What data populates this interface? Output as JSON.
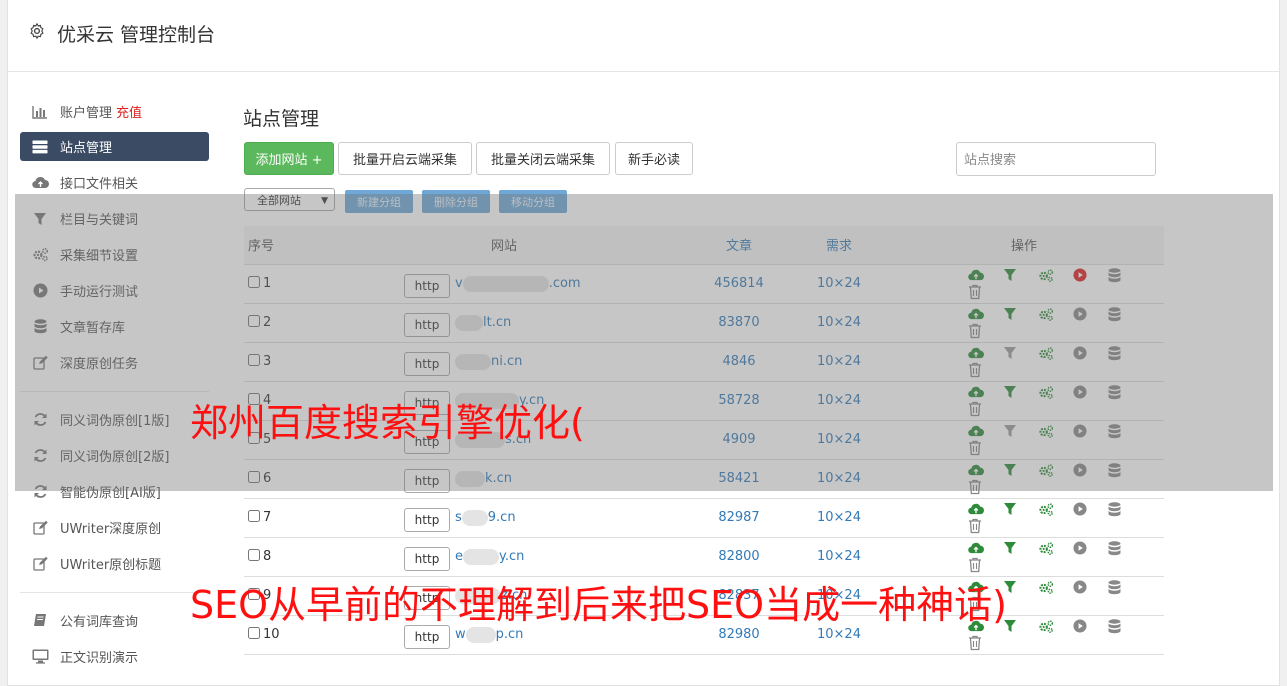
{
  "header": {
    "title": "优采云 管理控制台",
    "icon": "gear-icon"
  },
  "sidebar": {
    "items": [
      {
        "label": "账户管理",
        "badge": "充值",
        "icon": "bar-chart-icon"
      },
      {
        "label": "站点管理",
        "icon": "server-icon",
        "active": true
      },
      {
        "label": "接口文件相关",
        "icon": "cloud-upload-icon"
      },
      {
        "label": "栏目与关键词",
        "icon": "filter-icon"
      },
      {
        "label": "采集细节设置",
        "icon": "cogs-icon"
      },
      {
        "label": "手动运行测试",
        "icon": "play-circle-icon"
      },
      {
        "label": "文章暂存库",
        "icon": "database-icon"
      },
      {
        "label": "深度原创任务",
        "icon": "edit-icon"
      },
      {
        "label": "同义词伪原创[1版]",
        "icon": "refresh-icon"
      },
      {
        "label": "同义词伪原创[2版]",
        "icon": "refresh-icon"
      },
      {
        "label": "智能伪原创[AI版]",
        "icon": "refresh-icon"
      },
      {
        "label": "UWriter深度原创",
        "icon": "edit-icon"
      },
      {
        "label": "UWriter原创标题",
        "icon": "edit-icon"
      },
      {
        "label": "公有词库查询",
        "icon": "book-icon"
      },
      {
        "label": "正文识别演示",
        "icon": "monitor-icon"
      }
    ]
  },
  "main": {
    "title": "站点管理",
    "buttons": {
      "add": "添加网站 +",
      "batch_open": "批量开启云端采集",
      "batch_close": "批量关闭云端采集",
      "guide": "新手必读"
    },
    "search_placeholder": "站点搜索",
    "group_select": "全部网站",
    "group_buttons": {
      "new": "新建分组",
      "delete": "删除分组",
      "move": "移动分组"
    },
    "columns": {
      "no": "序号",
      "site": "网站",
      "articles": "文章",
      "demand": "需求",
      "ops": "操作"
    },
    "rows": [
      {
        "no": "1",
        "proto": "http",
        "url_prefix": "v",
        "url_suffix": ".com",
        "articles": "456814",
        "demand": "10×24",
        "running": true,
        "filter_active": true
      },
      {
        "no": "2",
        "proto": "http",
        "url_prefix": "",
        "url_suffix": "lt.cn",
        "articles": "83870",
        "demand": "10×24",
        "running": false,
        "filter_active": true
      },
      {
        "no": "3",
        "proto": "http",
        "url_prefix": "",
        "url_suffix": "ni.cn",
        "articles": "4846",
        "demand": "10×24",
        "running": false,
        "filter_active": false
      },
      {
        "no": "4",
        "proto": "http",
        "url_prefix": "",
        "url_suffix": "y.cn",
        "articles": "58728",
        "demand": "10×24",
        "running": false,
        "filter_active": true
      },
      {
        "no": "5",
        "proto": "http",
        "url_prefix": "",
        "url_suffix": "s.cn",
        "articles": "4909",
        "demand": "10×24",
        "running": false,
        "filter_active": false
      },
      {
        "no": "6",
        "proto": "http",
        "url_prefix": "",
        "url_suffix": "k.cn",
        "articles": "58421",
        "demand": "10×24",
        "running": false,
        "filter_active": true
      },
      {
        "no": "7",
        "proto": "http",
        "url_prefix": "s",
        "url_suffix": "9.cn",
        "articles": "82987",
        "demand": "10×24",
        "running": false,
        "filter_active": true
      },
      {
        "no": "8",
        "proto": "http",
        "url_prefix": "e",
        "url_suffix": "y.cn",
        "articles": "82800",
        "demand": "10×24",
        "running": false,
        "filter_active": true
      },
      {
        "no": "9",
        "proto": "http",
        "url_prefix": "",
        "url_suffix": "z.cn",
        "articles": "82837",
        "demand": "10×24",
        "running": false,
        "filter_active": true
      },
      {
        "no": "10",
        "proto": "http",
        "url_prefix": "w",
        "url_suffix": "p.cn",
        "articles": "82980",
        "demand": "10×24",
        "running": false,
        "filter_active": true
      }
    ]
  },
  "watermarks": {
    "line1": "郑州百度搜索引擎优化(",
    "line2": "SEO从早前的不理解到后来把SEO当成一种神话)"
  },
  "colors": {
    "active_bg": "#3a4b63",
    "green": "#5cb85c",
    "link": "#337ab7",
    "watermark": "#ff1010",
    "run_red": "#e02020"
  }
}
